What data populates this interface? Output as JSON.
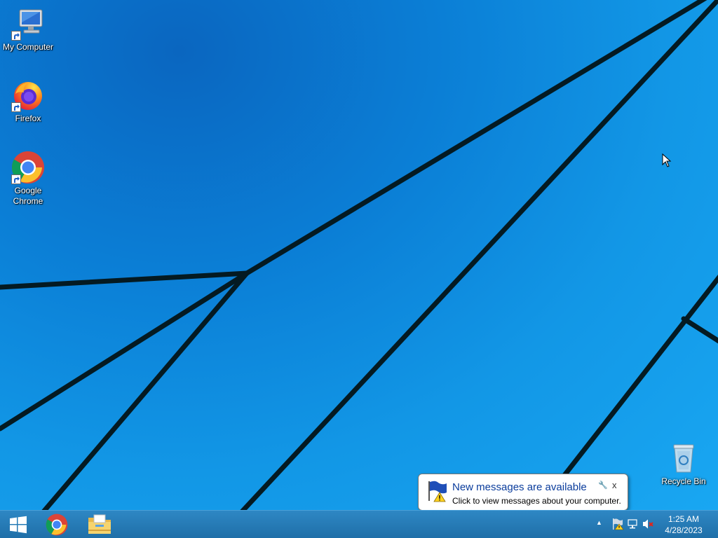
{
  "desktop": {
    "icons": [
      {
        "label": "My Computer",
        "icon": "my-computer-icon"
      },
      {
        "label": "Firefox",
        "icon": "firefox-icon"
      },
      {
        "label": "Google Chrome",
        "icon": "chrome-icon"
      },
      {
        "label": "Recycle Bin",
        "icon": "recycle-bin-icon"
      }
    ]
  },
  "taskbar": {
    "start_icon": "windows-logo-icon",
    "pinned": [
      {
        "icon": "chrome-icon"
      },
      {
        "icon": "file-explorer-icon"
      }
    ],
    "tray": {
      "show_hidden_glyph": "▲",
      "icons": [
        "action-center-warning-icon",
        "network-icon",
        "volume-muted-icon"
      ]
    },
    "clock": {
      "time": "1:25 AM",
      "date": "4/28/2023"
    }
  },
  "notification": {
    "title": "New messages are available",
    "text": "Click to view messages about your computer.",
    "close_glyph": "x",
    "options_glyph": "🔧",
    "icon": "action-center-flag-icon"
  },
  "colors": {
    "taskbar": "#1f6fa8",
    "wallpaper": "#1297e6",
    "balloon_title": "#0a3c9c"
  }
}
